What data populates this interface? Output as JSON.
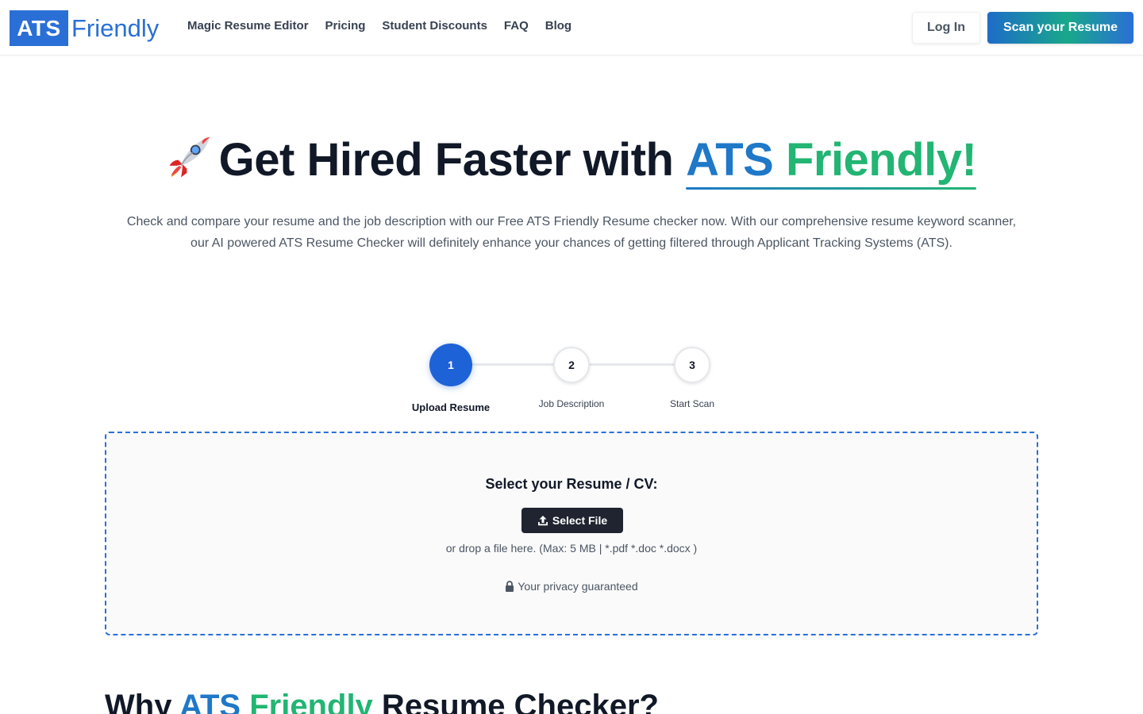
{
  "nav": {
    "logo_box": "ATS",
    "logo_text": "Friendly",
    "links": [
      "Magic Resume Editor",
      "Pricing",
      "Student Discounts",
      "FAQ",
      "Blog"
    ],
    "login_label": "Log In",
    "scan_label": "Scan your Resume"
  },
  "hero": {
    "rocket_icon": "rocket-icon",
    "title_prefix": "Get Hired Faster with ",
    "brand_ats": "ATS",
    "brand_friendly": "Friendly!",
    "subtitle": "Check and compare your resume and the job description with our Free ATS Friendly Resume checker now. With our comprehensive resume keyword scanner, our AI powered ATS Resume Checker will definitely enhance your chances of getting filtered through Applicant Tracking Systems (ATS)."
  },
  "stepper": {
    "steps": [
      {
        "number": "1",
        "label": "Upload Resume",
        "active": true
      },
      {
        "number": "2",
        "label": "Job Description",
        "active": false
      },
      {
        "number": "3",
        "label": "Start Scan",
        "active": false
      }
    ]
  },
  "upload": {
    "title": "Select your Resume / CV:",
    "button_label": "Select File",
    "hint": "or drop a file here. (Max: 5 MB | *.pdf *.doc *.docx )",
    "privacy": "Your privacy guaranteed"
  },
  "why": {
    "prefix": "Why ",
    "brand_ats": "ATS",
    "brand_friendly": "Friendly",
    "suffix": " Resume Checker?"
  },
  "colors": {
    "brand_blue": "#2a6fd6",
    "brand_green": "#22b573",
    "step_active": "#1e62d8",
    "dark_button": "#1f2430"
  }
}
